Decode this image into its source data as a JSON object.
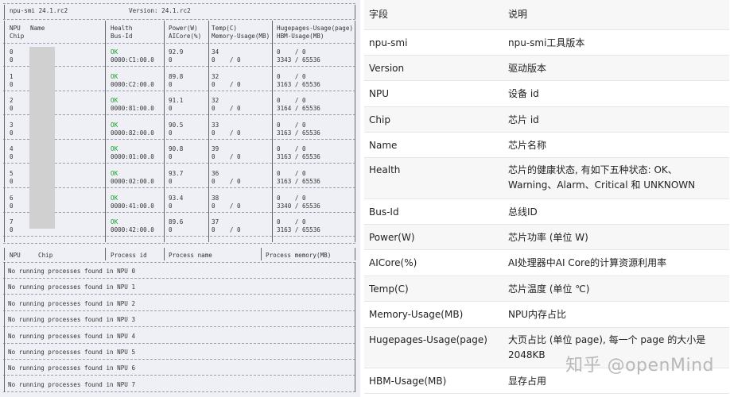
{
  "terminal": {
    "top_left": "npu-smi 24.1.rc2",
    "top_version": "Version: 24.1.rc2",
    "hdr1": [
      "NPU",
      "Name",
      "Health",
      "Power(W)",
      "Temp(C)",
      "Hugepages-Usage(page)"
    ],
    "hdr2": [
      "Chip",
      "Bus-Id",
      "AICore(%)",
      "Memory-Usage(MB)",
      "HBM-Usage(MB)"
    ],
    "npus": [
      {
        "npu": "0",
        "chip": "0",
        "health": "OK",
        "busid": "0000:C1:00.0",
        "power": "92.9",
        "aicore": "0",
        "temp": "34",
        "mem": "0    / 0",
        "huge": "0    / 0",
        "hbm": "3343 / 65536"
      },
      {
        "npu": "1",
        "chip": "0",
        "health": "OK",
        "busid": "0000:C2:00.0",
        "power": "89.8",
        "aicore": "0",
        "temp": "32",
        "mem": "0    / 0",
        "huge": "0    / 0",
        "hbm": "3163 / 65536"
      },
      {
        "npu": "2",
        "chip": "0",
        "health": "OK",
        "busid": "0000:81:00.0",
        "power": "91.1",
        "aicore": "0",
        "temp": "32",
        "mem": "0    / 0",
        "huge": "0    / 0",
        "hbm": "3164 / 65536"
      },
      {
        "npu": "3",
        "chip": "0",
        "health": "OK",
        "busid": "0000:82:00.0",
        "power": "90.5",
        "aicore": "0",
        "temp": "33",
        "mem": "0    / 0",
        "huge": "0    / 0",
        "hbm": "3163 / 65536"
      },
      {
        "npu": "4",
        "chip": "0",
        "health": "OK",
        "busid": "0000:01:00.0",
        "power": "90.8",
        "aicore": "0",
        "temp": "39",
        "mem": "0    / 0",
        "huge": "0    / 0",
        "hbm": "3163 / 65536"
      },
      {
        "npu": "5",
        "chip": "0",
        "health": "OK",
        "busid": "0000:02:00.0",
        "power": "93.7",
        "aicore": "0",
        "temp": "36",
        "mem": "0    / 0",
        "huge": "0    / 0",
        "hbm": "3163 / 65536"
      },
      {
        "npu": "6",
        "chip": "0",
        "health": "OK",
        "busid": "0000:41:00.0",
        "power": "93.4",
        "aicore": "0",
        "temp": "38",
        "mem": "0    / 0",
        "huge": "0    / 0",
        "hbm": "3340 / 65536"
      },
      {
        "npu": "7",
        "chip": "0",
        "health": "OK",
        "busid": "0000:42:00.0",
        "power": "89.6",
        "aicore": "0",
        "temp": "37",
        "mem": "0    / 0",
        "huge": "0    / 0",
        "hbm": "3163 / 65536"
      }
    ],
    "proc_header": [
      "NPU",
      "Chip",
      "Process id",
      "Process name",
      "Process memory(MB)"
    ],
    "no_proc": [
      "No running processes found in NPU 0",
      "No running processes found in NPU 1",
      "No running processes found in NPU 2",
      "No running processes found in NPU 3",
      "No running processes found in NPU 4",
      "No running processes found in NPU 5",
      "No running processes found in NPU 6",
      "No running processes found in NPU 7"
    ]
  },
  "doc": {
    "rows": [
      [
        "字段",
        "说明"
      ],
      [
        "npu-smi",
        "npu-smi工具版本"
      ],
      [
        "Version",
        "驱动版本"
      ],
      [
        "NPU",
        "设备 id"
      ],
      [
        "Chip",
        "芯片 id"
      ],
      [
        "Name",
        "芯片名称"
      ],
      [
        "Health",
        "芯片的健康状态, 有如下五种状态: OK、Warning、Alarm、Critical 和 UNKNOWN"
      ],
      [
        "Bus-Id",
        "总线ID"
      ],
      [
        "Power(W)",
        "芯片功率 (单位 W)"
      ],
      [
        "AICore(%)",
        "AI处理器中AI Core的计算资源利用率"
      ],
      [
        "Temp(C)",
        "芯片温度 (单位 ℃)"
      ],
      [
        "Memory-Usage(MB)",
        "NPU内存占比"
      ],
      [
        "Hugepages-Usage(page)",
        "大页占比 (单位 page), 每一个 page 的大小是 2048KB"
      ],
      [
        "HBM-Usage(MB)",
        "显存占用"
      ]
    ],
    "watermark": "知乎 @openMind"
  }
}
